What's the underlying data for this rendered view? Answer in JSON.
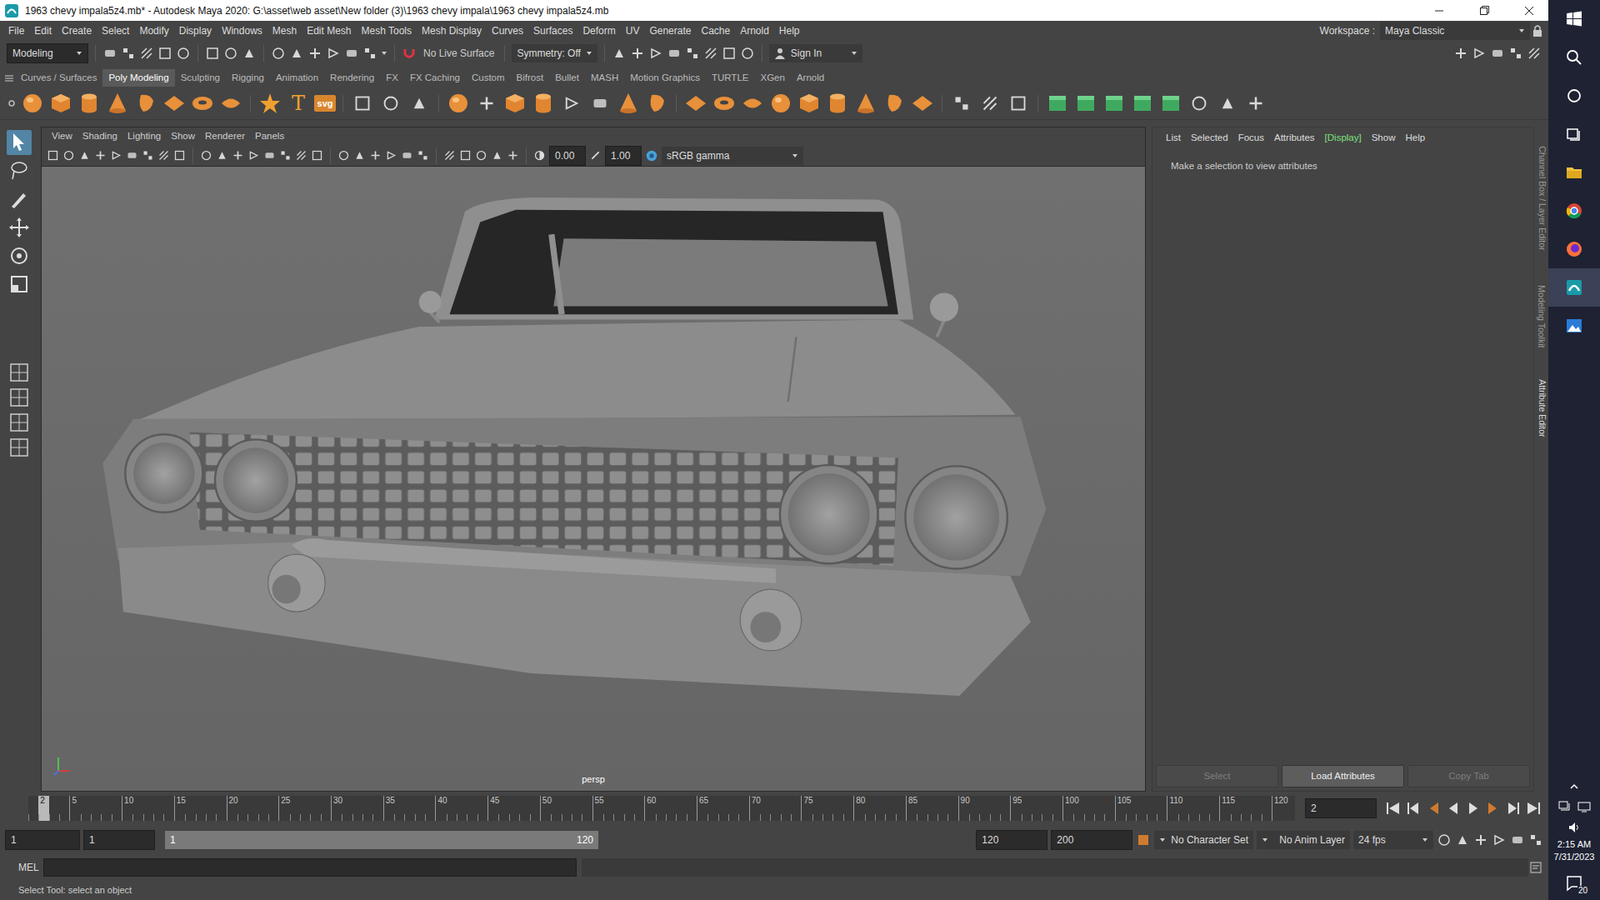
{
  "window": {
    "title": "1963 chevy impala5z4.mb* - Autodesk Maya 2020: G:\\asset\\web asset\\New folder (3)\\1963 chevy impala\\1963 chevy impala5z4.mb"
  },
  "menu": [
    "File",
    "Edit",
    "Create",
    "Select",
    "Modify",
    "Display",
    "Windows",
    "Mesh",
    "Edit Mesh",
    "Mesh Tools",
    "Mesh Display",
    "Curves",
    "Surfaces",
    "Deform",
    "UV",
    "Generate",
    "Cache",
    "Arnold",
    "Help"
  ],
  "workspace": {
    "label": "Workspace :",
    "value": "Maya Classic"
  },
  "status_line": {
    "mode": "Modeling",
    "live_surface": "No Live Surface",
    "symmetry": "Symmetry: Off",
    "sign_in": "Sign In"
  },
  "shelf": {
    "tabs": [
      {
        "label": "Curves / Surfaces",
        "selected": false
      },
      {
        "label": "Poly Modeling",
        "selected": true
      },
      {
        "label": "Sculpting",
        "selected": false
      },
      {
        "label": "Rigging",
        "selected": false
      },
      {
        "label": "Animation",
        "selected": false
      },
      {
        "label": "Rendering",
        "selected": false
      },
      {
        "label": "FX",
        "selected": false
      },
      {
        "label": "FX Caching",
        "selected": false
      },
      {
        "label": "Custom",
        "selected": false
      },
      {
        "label": "Bifrost",
        "selected": false
      },
      {
        "label": "Bullet",
        "selected": false
      },
      {
        "label": "MASH",
        "selected": false
      },
      {
        "label": "Motion Graphics",
        "selected": false
      },
      {
        "label": "TURTLE",
        "selected": false
      },
      {
        "label": "XGen",
        "selected": false
      },
      {
        "label": "Arnold",
        "selected": false
      }
    ],
    "text_icons": [
      "T",
      "svg"
    ]
  },
  "viewport": {
    "menu": [
      "View",
      "Shading",
      "Lighting",
      "Show",
      "Renderer",
      "Panels"
    ],
    "exposure": "0.00",
    "gamma": "1.00",
    "color_space": "sRGB gamma",
    "camera": "persp"
  },
  "attribute_editor": {
    "tabs": [
      {
        "label": "List",
        "selected": false
      },
      {
        "label": "Selected",
        "selected": false
      },
      {
        "label": "Focus",
        "selected": false
      },
      {
        "label": "Attributes",
        "selected": false
      },
      {
        "label": "[Display]",
        "selected": true
      },
      {
        "label": "Show",
        "selected": false
      },
      {
        "label": "Help",
        "selected": false
      }
    ],
    "message": "Make a selection to view attributes",
    "buttons": [
      {
        "label": "Select",
        "disabled": true
      },
      {
        "label": "Load Attributes",
        "disabled": false
      },
      {
        "label": "Copy Tab",
        "disabled": true
      }
    ]
  },
  "side_tabs": [
    {
      "label": "Channel Box / Layer Editor",
      "selected": false
    },
    {
      "label": "Modeling Toolkit",
      "selected": false
    },
    {
      "label": "Attribute Editor",
      "selected": true
    }
  ],
  "time_slider": {
    "ticks": [
      "5",
      "10",
      "15",
      "20",
      "25",
      "30",
      "35",
      "40",
      "45",
      "50",
      "55",
      "60",
      "65",
      "70",
      "75",
      "80",
      "85",
      "90",
      "95",
      "100",
      "105",
      "110",
      "115",
      "120"
    ],
    "current": "2",
    "current_field": "2"
  },
  "range_slider": {
    "start": "1",
    "range_start": "1",
    "inner_start": "1",
    "inner_end": "120",
    "range_end": "120",
    "end": "200",
    "character_set": "No Character Set",
    "anim_layer": "No Anim Layer",
    "fps": "24 fps"
  },
  "command_line": {
    "language": "MEL"
  },
  "help_line": "Select Tool: select an object",
  "taskbar": {
    "time": "2:15 AM",
    "date": "7/31/2023",
    "notifications": "20"
  }
}
